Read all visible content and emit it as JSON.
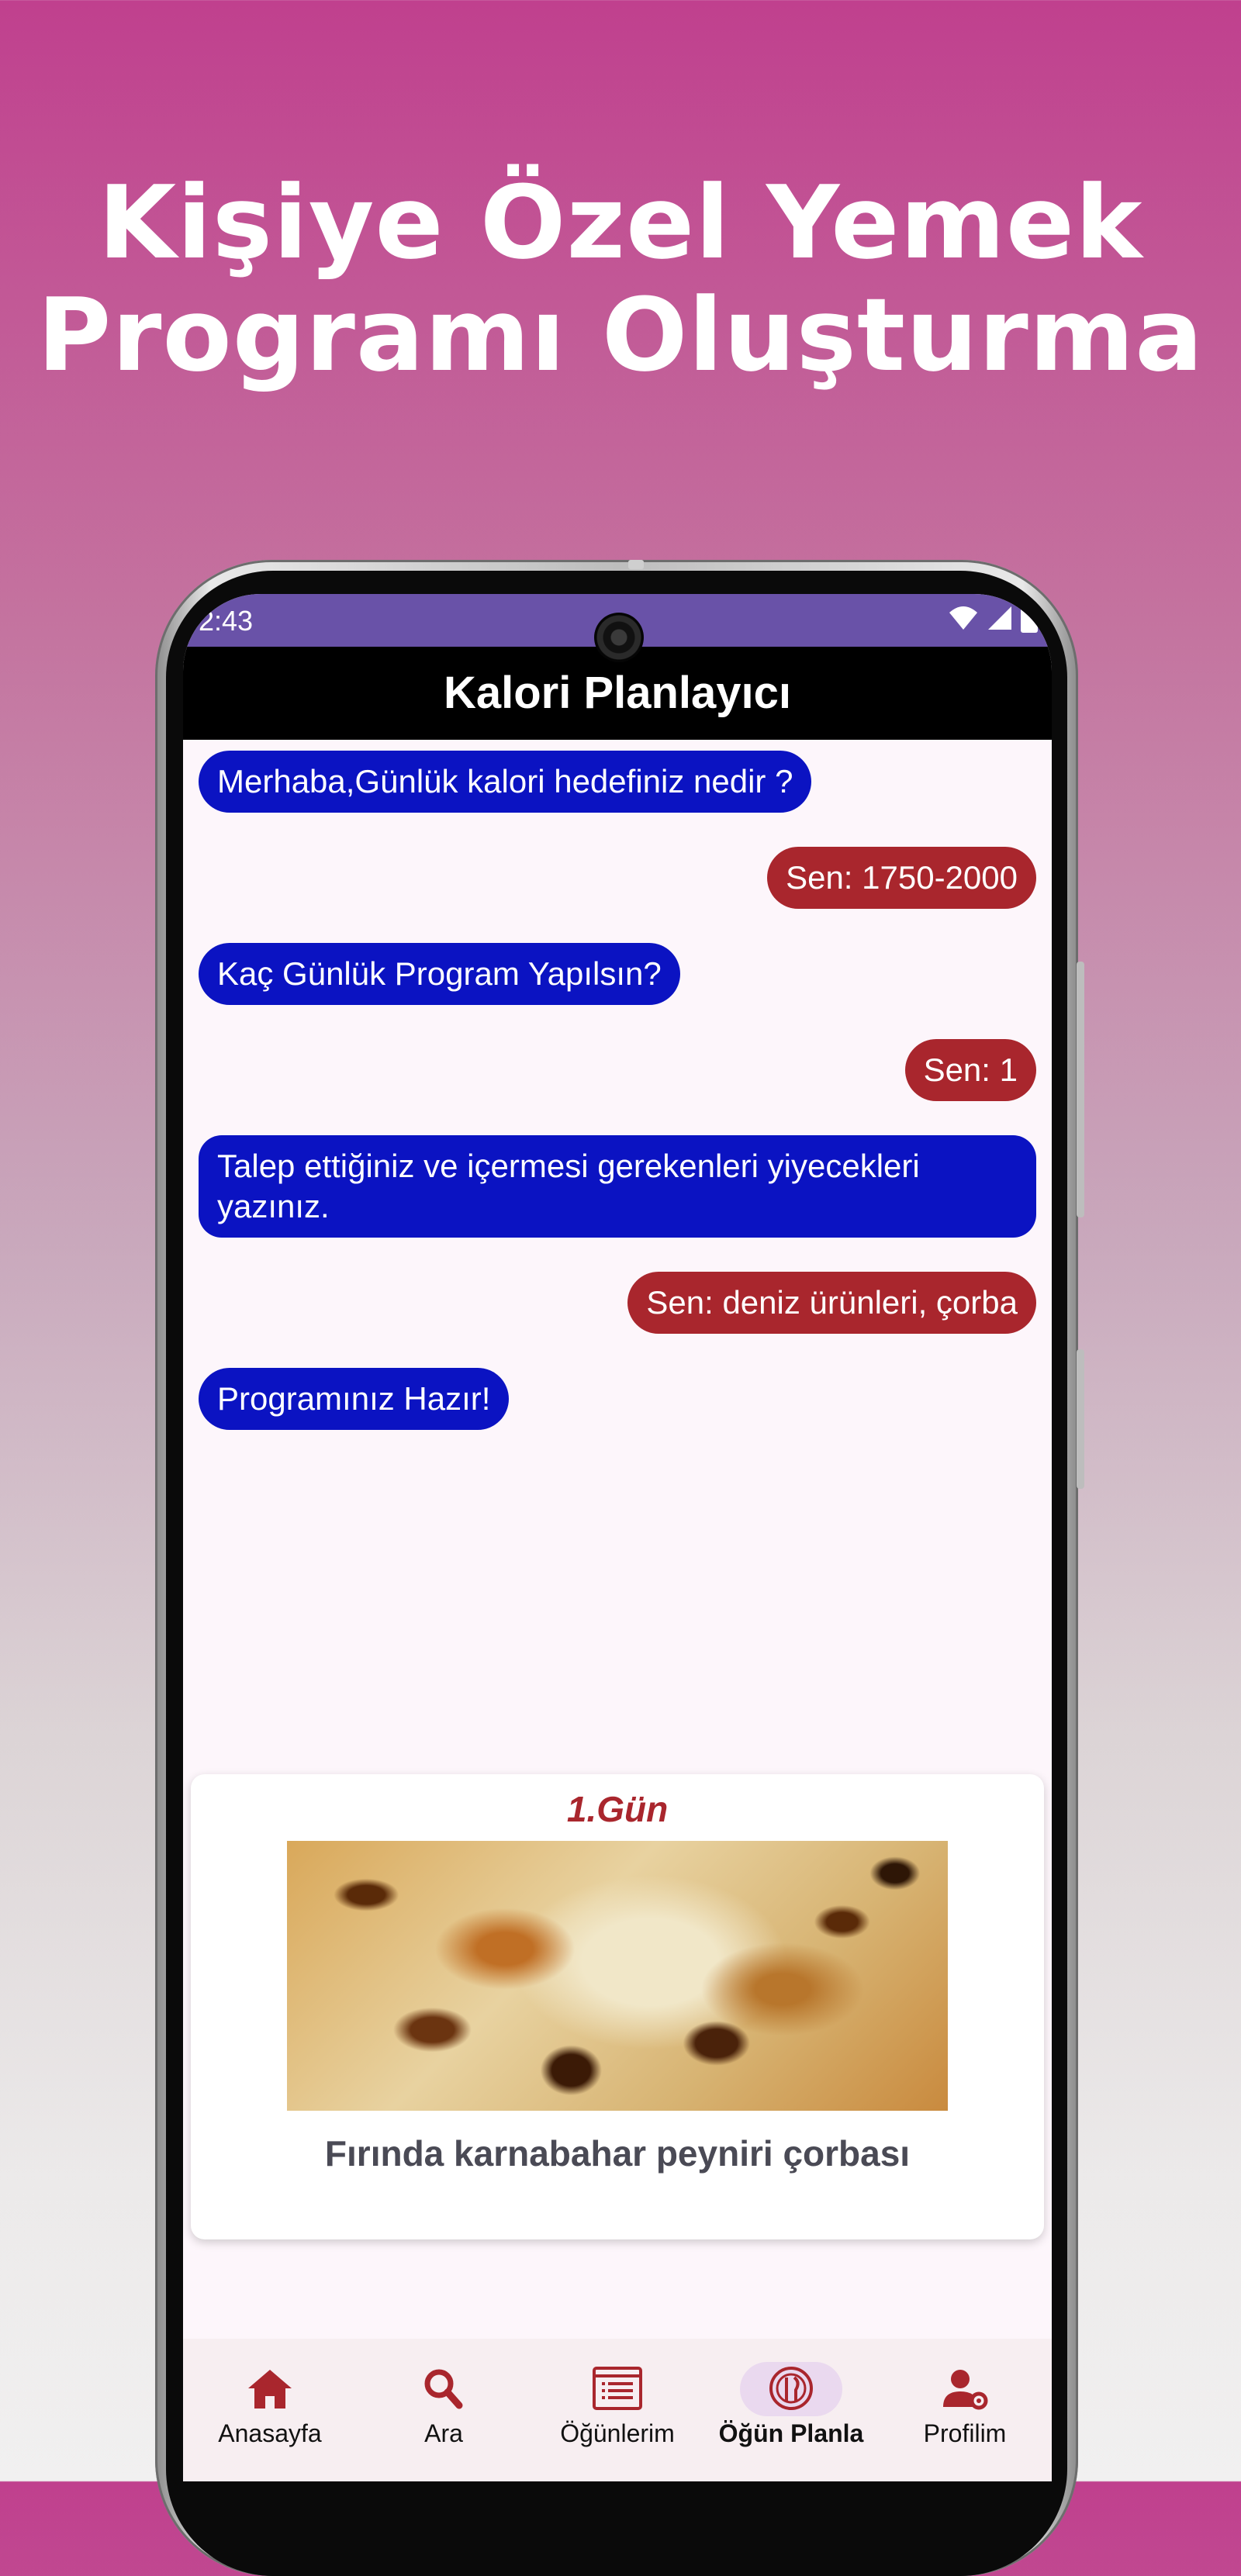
{
  "headline": {
    "line1": "Kişiye Özel Yemek",
    "line2": "Programı Oluşturma"
  },
  "status_bar": {
    "time": "2:43",
    "icons": [
      "wifi-icon",
      "signal-icon",
      "battery-icon"
    ]
  },
  "app_bar": {
    "title": "Kalori Planlayıcı"
  },
  "chat": {
    "messages": [
      {
        "sender": "bot",
        "text": "Merhaba,Günlük kalori hedefiniz nedir ?"
      },
      {
        "sender": "user",
        "text": "Sen: 1750-2000"
      },
      {
        "sender": "bot",
        "text": "Kaç Günlük Program Yapılsın?"
      },
      {
        "sender": "user",
        "text": "Sen: 1"
      },
      {
        "sender": "bot",
        "text": "Talep ettiğiniz ve içermesi gerekenleri yiyecekleri yazınız."
      },
      {
        "sender": "user",
        "text": "Sen: deniz ürünleri, çorba"
      },
      {
        "sender": "bot",
        "text": "Programınız Hazır!"
      }
    ]
  },
  "program_card": {
    "day_label": "1.Gün",
    "food_name": "Fırında karnabahar peyniri çorbası"
  },
  "bottom_nav": {
    "items": [
      {
        "label": "Anasayfa",
        "icon": "home-icon"
      },
      {
        "label": "Ara",
        "icon": "search-icon"
      },
      {
        "label": "Öğünlerim",
        "icon": "menu-list-icon"
      },
      {
        "label": "Öğün Planla",
        "icon": "plate-utensils-icon",
        "active": true
      },
      {
        "label": "Profilim",
        "icon": "person-settings-icon"
      }
    ]
  },
  "colors": {
    "accent_red": "#a9262d",
    "bot_bubble": "#0b13c2",
    "status_bar": "#6952a8",
    "app_bar": "#000000",
    "active_nav_pill": "#ead9ef"
  }
}
